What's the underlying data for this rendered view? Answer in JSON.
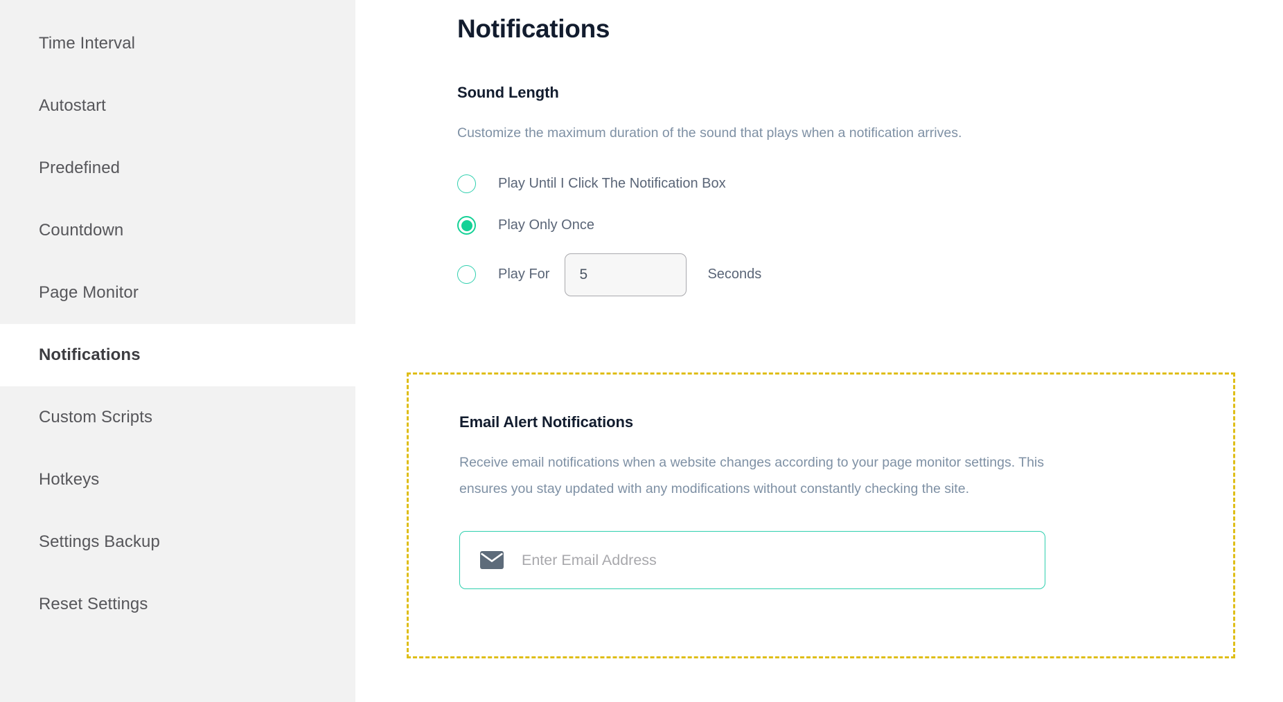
{
  "sidebar": {
    "items": [
      {
        "label": "Time Interval",
        "active": false
      },
      {
        "label": "Autostart",
        "active": false
      },
      {
        "label": "Predefined",
        "active": false
      },
      {
        "label": "Countdown",
        "active": false
      },
      {
        "label": "Page Monitor",
        "active": false
      },
      {
        "label": "Notifications",
        "active": true
      },
      {
        "label": "Custom Scripts",
        "active": false
      },
      {
        "label": "Hotkeys",
        "active": false
      },
      {
        "label": "Settings Backup",
        "active": false
      },
      {
        "label": "Reset Settings",
        "active": false
      }
    ]
  },
  "main": {
    "page_title": "Notifications",
    "sound_length": {
      "heading": "Sound Length",
      "description": "Customize the maximum duration of the sound that plays when a notification arrives.",
      "options": [
        {
          "label": "Play Until I Click The Notification Box",
          "selected": false
        },
        {
          "label": "Play Only Once",
          "selected": true
        },
        {
          "label": "Play For",
          "selected": false
        }
      ],
      "seconds_value": "5",
      "seconds_unit": "Seconds"
    },
    "email_alerts": {
      "heading": "Email Alert Notifications",
      "description": "Receive email notifications when a website changes according to your page monitor settings. This ensures you stay updated with any modifications without constantly checking the site.",
      "email_placeholder": "Enter Email Address",
      "email_value": "",
      "icon": "envelope-icon"
    }
  },
  "colors": {
    "sidebar_bg": "#f2f2f2",
    "active_bg": "#ffffff",
    "title": "#121c2e",
    "body_text": "#7e90a4",
    "accent_teal": "#2ecfae",
    "accent_green": "#14d196",
    "highlight_dashed": "#dfbe18",
    "envelope_icon": "#5d6b7a"
  }
}
